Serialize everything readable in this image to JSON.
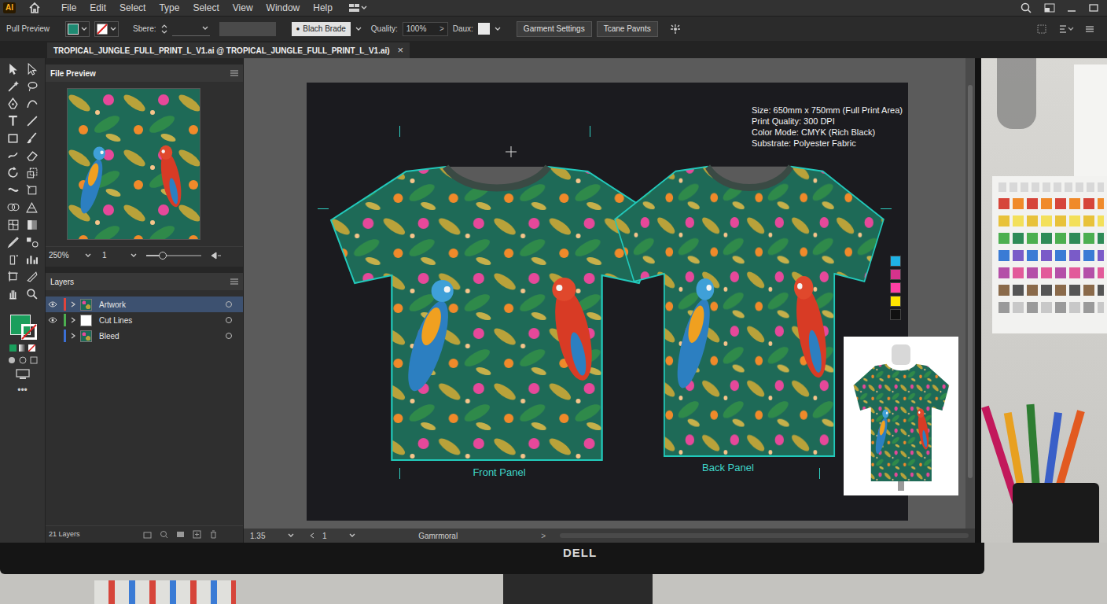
{
  "app": {
    "logo": "AI"
  },
  "menu": [
    "File",
    "Edit",
    "Select",
    "Type",
    "Select",
    "View",
    "Window",
    "Help"
  ],
  "control_bar": {
    "mode": "Pull Preview",
    "shape_label": "Sbere:",
    "brush": {
      "bullet": "●",
      "label": "Blach Brade"
    },
    "quality_label": "Quality:",
    "quality_value": "100%",
    "quality_arrow": ">",
    "density_label": "Daux:",
    "buttons": [
      "Garment Settings",
      "Tcane Pavnts"
    ]
  },
  "document_tab": {
    "title": "TROPICAL_JUNGLE_FULL_PRINT_L_V1.ai @ TROPICAL_JUNGLE_FULL_PRINT_L_V1.ai)",
    "close": "×"
  },
  "file_preview": {
    "title": "File Preview",
    "zoom": "250%",
    "page": "1",
    "zoom_slider": {
      "level": 0.3
    }
  },
  "layers": {
    "title": "Layers",
    "items": [
      {
        "name": "Artwork",
        "visible": true,
        "selected": true,
        "color": "#e0443c",
        "kind": "artwork"
      },
      {
        "name": "Cut Lines",
        "visible": true,
        "selected": false,
        "color": "#4caf50",
        "kind": "blank"
      },
      {
        "name": "Bleed",
        "visible": false,
        "selected": false,
        "color": "#3b6fd4",
        "kind": "artwork"
      }
    ],
    "count": "21 Layers"
  },
  "toolbar": {
    "more": "•••"
  },
  "artboard": {
    "specs": [
      "Size: 650mm x 750mm (Full Print Area)",
      "Print Quality: 300 DPI",
      "Color Mode: CMYK (Rich Black)",
      "Substrate: Polyester Fabric"
    ],
    "panels": [
      {
        "label": "Front Panel"
      },
      {
        "label": "Back Panel"
      }
    ],
    "swatches": [
      {
        "color": "#1fb3e6"
      },
      {
        "color": "#d6338c"
      },
      {
        "color": "#ff3fa4"
      },
      {
        "color": "#ffe400"
      },
      {
        "color": "#111111"
      }
    ]
  },
  "status_bar": {
    "zoom": "1.35",
    "page": "1",
    "label": "Gamrmoral",
    "arrow": ">"
  },
  "monitor": {
    "brand": "DELL"
  }
}
